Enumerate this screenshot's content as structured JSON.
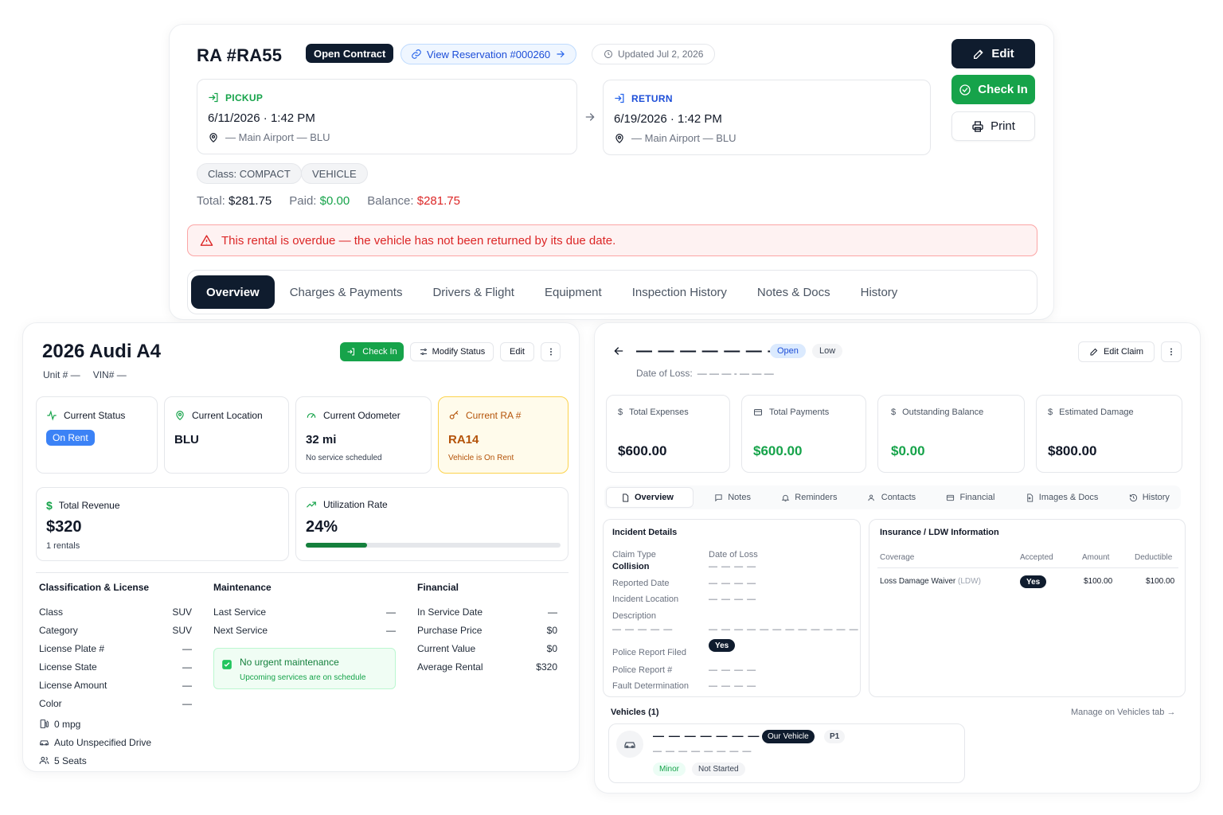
{
  "ra": {
    "title": "RA #RA55",
    "status_badge": "Open Contract",
    "reservation_link": "View Reservation #000260",
    "updated": "Updated Jul 2, 2026",
    "actions": {
      "edit": "Edit",
      "check_in": "Check In",
      "print": "Print"
    },
    "pickup": {
      "label": "PICKUP",
      "datetime": "6/11/2026 · 1:42 PM",
      "location": "— Main Airport — BLU"
    },
    "return": {
      "label": "RETURN",
      "datetime": "6/19/2026 · 1:42 PM",
      "location": "— Main Airport — BLU"
    },
    "class_pill": "Class: COMPACT",
    "vehicle_pill": "VEHICLE",
    "totals": {
      "total_label": "Total:",
      "total_value": "$281.75",
      "paid_label": "Paid:",
      "paid_value": "$0.00",
      "balance_label": "Balance:",
      "balance_value": "$281.75"
    },
    "overdue_alert": "This rental is overdue — the vehicle has not been returned by its due date.",
    "tabs": [
      "Overview",
      "Charges & Payments",
      "Drivers & Flight",
      "Equipment",
      "Inspection History",
      "Notes & Docs",
      "History"
    ]
  },
  "vehicle": {
    "title": "2026 Audi A4",
    "unit": "Unit # —",
    "vin": "VIN# —",
    "actions": {
      "check_in": "Check In",
      "modify_status": "Modify Status",
      "edit": "Edit"
    },
    "stats": {
      "status_label": "Current Status",
      "status_value": "On Rent",
      "location_label": "Current Location",
      "location_value": "BLU",
      "odometer_label": "Current Odometer",
      "odometer_value": "32 mi",
      "odometer_note": "No service scheduled",
      "ra_label": "Current RA #",
      "ra_value": "RA14",
      "ra_note": "Vehicle is On Rent"
    },
    "revenue": {
      "label": "Total Revenue",
      "value": "$320",
      "note": "1 rentals"
    },
    "utilization": {
      "label": "Utilization Rate",
      "value": "24%",
      "percent": 24
    },
    "classification": {
      "heading": "Classification & License",
      "rows": [
        {
          "k": "Class",
          "v": "SUV"
        },
        {
          "k": "Category",
          "v": "SUV"
        },
        {
          "k": "License Plate #",
          "v": "—"
        },
        {
          "k": "License State",
          "v": "—"
        },
        {
          "k": "License Amount",
          "v": "—"
        },
        {
          "k": "Color",
          "v": "—"
        }
      ],
      "mpg": "0 mpg",
      "drive": "Auto Unspecified Drive",
      "seats": "5 Seats"
    },
    "maintenance": {
      "heading": "Maintenance",
      "rows": [
        {
          "k": "Last Service",
          "v": "—"
        },
        {
          "k": "Next Service",
          "v": "—"
        }
      ],
      "ok_title": "No urgent maintenance",
      "ok_note": "Upcoming services are on schedule"
    },
    "financial": {
      "heading": "Financial",
      "rows": [
        {
          "k": "In Service Date",
          "v": "—"
        },
        {
          "k": "Purchase Price",
          "v": "$0"
        },
        {
          "k": "Current Value",
          "v": "$0"
        },
        {
          "k": "Average Rental",
          "v": "$320"
        }
      ]
    }
  },
  "claim": {
    "title_placeholder": "— — — — — — —",
    "status": "Open",
    "priority": "Low",
    "edit": "Edit Claim",
    "date_of_loss_label": "Date of Loss:",
    "date_of_loss_value": "— — — - — — —",
    "stats": {
      "expenses_label": "Total Expenses",
      "expenses_value": "$600.00",
      "payments_label": "Total Payments",
      "payments_value": "$600.00",
      "outstanding_label": "Outstanding Balance",
      "outstanding_value": "$0.00",
      "damage_label": "Estimated Damage",
      "damage_value": "$800.00"
    },
    "tabs": [
      "Overview",
      "Notes",
      "Reminders",
      "Contacts",
      "Financial",
      "Images & Docs",
      "History"
    ],
    "incident": {
      "heading": "Incident Details",
      "claim_type_label": "Claim Type",
      "claim_type_value": "Collision",
      "date_of_loss_label": "Date of Loss",
      "date_of_loss_value": "— — — —",
      "reported_label": "Reported Date",
      "reported_value": "— — — —",
      "location_label": "Incident Location",
      "location_value": "— — — —",
      "description_label": "Description",
      "description_value": "— — — — —",
      "description_value2": "— — — — — — — — — — — —",
      "police_filed_label": "Police Report Filed",
      "police_filed_value": "Yes",
      "police_num_label": "Police Report #",
      "police_num_value": "— — — —",
      "fault_label": "Fault Determination",
      "fault_value": "— — — —"
    },
    "insurance": {
      "heading": "Insurance / LDW Information",
      "columns": [
        "Coverage",
        "Accepted",
        "Amount",
        "Deductible"
      ],
      "row": {
        "coverage": "Loss Damage Waiver",
        "coverage_code": "(LDW)",
        "accepted": "Yes",
        "amount": "$100.00",
        "deductible": "$100.00"
      }
    },
    "vehicles": {
      "heading": "Vehicles (1)",
      "manage": "Manage on Vehicles tab →",
      "name_placeholder": "— — — — — — —",
      "our_vehicle": "Our Vehicle",
      "position": "P1",
      "sub_placeholder": "— — — — — — — —",
      "severity": "Minor",
      "repair_status": "Not Started"
    }
  },
  "colors": {
    "navy": "#0f1c2e",
    "green": "#16a34a",
    "red": "#dc2626",
    "blue": "#2563eb",
    "amber": "#b45309"
  }
}
